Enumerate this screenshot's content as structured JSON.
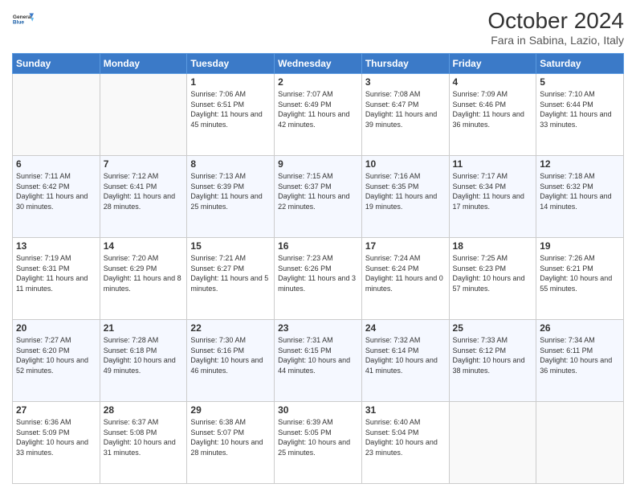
{
  "logo": {
    "line1": "General",
    "line2": "Blue"
  },
  "title": "October 2024",
  "location": "Fara in Sabina, Lazio, Italy",
  "days_header": [
    "Sunday",
    "Monday",
    "Tuesday",
    "Wednesday",
    "Thursday",
    "Friday",
    "Saturday"
  ],
  "weeks": [
    [
      {
        "day": "",
        "info": ""
      },
      {
        "day": "",
        "info": ""
      },
      {
        "day": "1",
        "info": "Sunrise: 7:06 AM\nSunset: 6:51 PM\nDaylight: 11 hours and 45 minutes."
      },
      {
        "day": "2",
        "info": "Sunrise: 7:07 AM\nSunset: 6:49 PM\nDaylight: 11 hours and 42 minutes."
      },
      {
        "day": "3",
        "info": "Sunrise: 7:08 AM\nSunset: 6:47 PM\nDaylight: 11 hours and 39 minutes."
      },
      {
        "day": "4",
        "info": "Sunrise: 7:09 AM\nSunset: 6:46 PM\nDaylight: 11 hours and 36 minutes."
      },
      {
        "day": "5",
        "info": "Sunrise: 7:10 AM\nSunset: 6:44 PM\nDaylight: 11 hours and 33 minutes."
      }
    ],
    [
      {
        "day": "6",
        "info": "Sunrise: 7:11 AM\nSunset: 6:42 PM\nDaylight: 11 hours and 30 minutes."
      },
      {
        "day": "7",
        "info": "Sunrise: 7:12 AM\nSunset: 6:41 PM\nDaylight: 11 hours and 28 minutes."
      },
      {
        "day": "8",
        "info": "Sunrise: 7:13 AM\nSunset: 6:39 PM\nDaylight: 11 hours and 25 minutes."
      },
      {
        "day": "9",
        "info": "Sunrise: 7:15 AM\nSunset: 6:37 PM\nDaylight: 11 hours and 22 minutes."
      },
      {
        "day": "10",
        "info": "Sunrise: 7:16 AM\nSunset: 6:35 PM\nDaylight: 11 hours and 19 minutes."
      },
      {
        "day": "11",
        "info": "Sunrise: 7:17 AM\nSunset: 6:34 PM\nDaylight: 11 hours and 17 minutes."
      },
      {
        "day": "12",
        "info": "Sunrise: 7:18 AM\nSunset: 6:32 PM\nDaylight: 11 hours and 14 minutes."
      }
    ],
    [
      {
        "day": "13",
        "info": "Sunrise: 7:19 AM\nSunset: 6:31 PM\nDaylight: 11 hours and 11 minutes."
      },
      {
        "day": "14",
        "info": "Sunrise: 7:20 AM\nSunset: 6:29 PM\nDaylight: 11 hours and 8 minutes."
      },
      {
        "day": "15",
        "info": "Sunrise: 7:21 AM\nSunset: 6:27 PM\nDaylight: 11 hours and 5 minutes."
      },
      {
        "day": "16",
        "info": "Sunrise: 7:23 AM\nSunset: 6:26 PM\nDaylight: 11 hours and 3 minutes."
      },
      {
        "day": "17",
        "info": "Sunrise: 7:24 AM\nSunset: 6:24 PM\nDaylight: 11 hours and 0 minutes."
      },
      {
        "day": "18",
        "info": "Sunrise: 7:25 AM\nSunset: 6:23 PM\nDaylight: 10 hours and 57 minutes."
      },
      {
        "day": "19",
        "info": "Sunrise: 7:26 AM\nSunset: 6:21 PM\nDaylight: 10 hours and 55 minutes."
      }
    ],
    [
      {
        "day": "20",
        "info": "Sunrise: 7:27 AM\nSunset: 6:20 PM\nDaylight: 10 hours and 52 minutes."
      },
      {
        "day": "21",
        "info": "Sunrise: 7:28 AM\nSunset: 6:18 PM\nDaylight: 10 hours and 49 minutes."
      },
      {
        "day": "22",
        "info": "Sunrise: 7:30 AM\nSunset: 6:16 PM\nDaylight: 10 hours and 46 minutes."
      },
      {
        "day": "23",
        "info": "Sunrise: 7:31 AM\nSunset: 6:15 PM\nDaylight: 10 hours and 44 minutes."
      },
      {
        "day": "24",
        "info": "Sunrise: 7:32 AM\nSunset: 6:14 PM\nDaylight: 10 hours and 41 minutes."
      },
      {
        "day": "25",
        "info": "Sunrise: 7:33 AM\nSunset: 6:12 PM\nDaylight: 10 hours and 38 minutes."
      },
      {
        "day": "26",
        "info": "Sunrise: 7:34 AM\nSunset: 6:11 PM\nDaylight: 10 hours and 36 minutes."
      }
    ],
    [
      {
        "day": "27",
        "info": "Sunrise: 6:36 AM\nSunset: 5:09 PM\nDaylight: 10 hours and 33 minutes."
      },
      {
        "day": "28",
        "info": "Sunrise: 6:37 AM\nSunset: 5:08 PM\nDaylight: 10 hours and 31 minutes."
      },
      {
        "day": "29",
        "info": "Sunrise: 6:38 AM\nSunset: 5:07 PM\nDaylight: 10 hours and 28 minutes."
      },
      {
        "day": "30",
        "info": "Sunrise: 6:39 AM\nSunset: 5:05 PM\nDaylight: 10 hours and 25 minutes."
      },
      {
        "day": "31",
        "info": "Sunrise: 6:40 AM\nSunset: 5:04 PM\nDaylight: 10 hours and 23 minutes."
      },
      {
        "day": "",
        "info": ""
      },
      {
        "day": "",
        "info": ""
      }
    ]
  ]
}
